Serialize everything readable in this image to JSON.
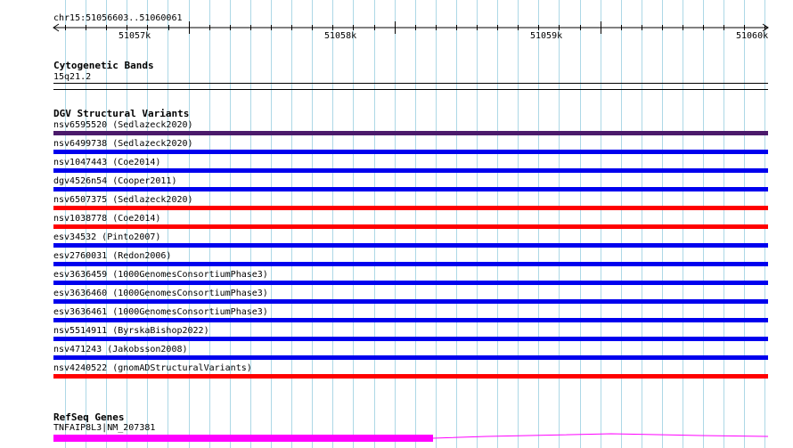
{
  "ruler": {
    "location": "chr15:51056603..51060061",
    "ticks": [
      "51057k",
      "51058k",
      "51059k",
      "51060k"
    ]
  },
  "tracks": {
    "cytoband": {
      "title": "Cytogenetic Bands",
      "band": "15q21.2"
    },
    "dgv": {
      "title": "DGV Structural Variants",
      "variants": [
        {
          "label": "nsv6595520 (Sedlazeck2020)",
          "color": "#4b1a6b"
        },
        {
          "label": "nsv6499738 (Sedlazeck2020)",
          "color": "#0000ee"
        },
        {
          "label": "nsv1047443 (Coe2014)",
          "color": "#0000ee"
        },
        {
          "label": "dgv4526n54 (Cooper2011)",
          "color": "#0000ee"
        },
        {
          "label": "nsv6507375 (Sedlazeck2020)",
          "color": "#ff0000"
        },
        {
          "label": "nsv1038778 (Coe2014)",
          "color": "#ff0000"
        },
        {
          "label": "esv34532 (Pinto2007)",
          "color": "#0000ee"
        },
        {
          "label": "esv2760031 (Redon2006)",
          "color": "#0000ee"
        },
        {
          "label": "esv3636459 (1000GenomesConsortiumPhase3)",
          "color": "#0000ee"
        },
        {
          "label": "esv3636460 (1000GenomesConsortiumPhase3)",
          "color": "#0000ee"
        },
        {
          "label": "esv3636461 (1000GenomesConsortiumPhase3)",
          "color": "#0000ee"
        },
        {
          "label": "nsv5514911 (ByrskaBishop2022)",
          "color": "#0000ee"
        },
        {
          "label": "nsv471243 (Jakobsson2008)",
          "color": "#0000ee"
        },
        {
          "label": "nsv4240522 (gnomADStructuralVariants)",
          "color": "#ff0000"
        }
      ]
    },
    "refseq": {
      "title": "RefSeq Genes",
      "gene": "TNFAIP8L3|NM_207381",
      "exon_color": "#ff00ff",
      "intron_color": "#ff00ff"
    }
  },
  "colors": {
    "gridline": "#add8e6"
  }
}
